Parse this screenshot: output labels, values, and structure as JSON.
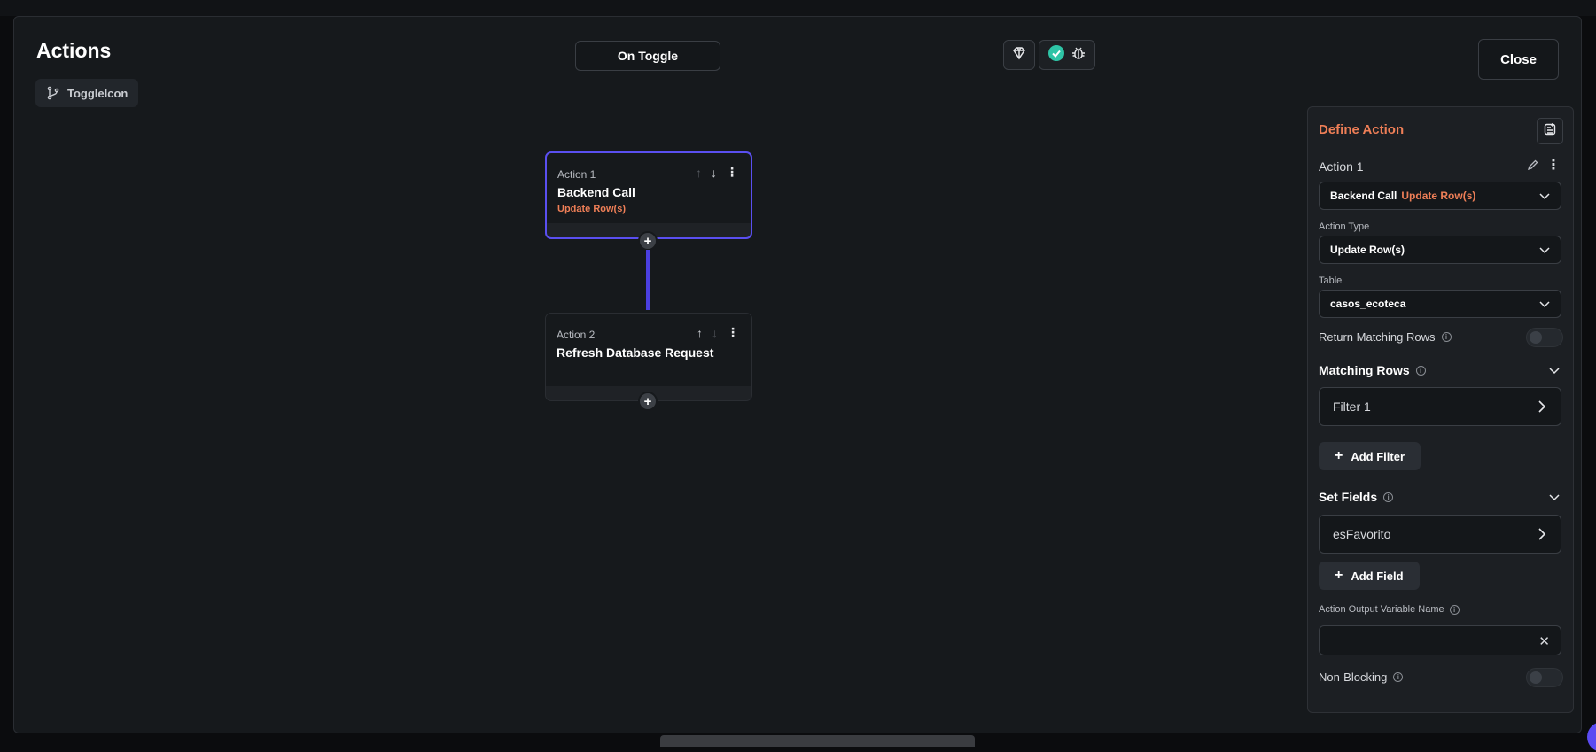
{
  "header": {
    "title": "Actions",
    "component_chip": "ToggleIcon",
    "trigger_label": "On Toggle",
    "close_label": "Close"
  },
  "flow": {
    "nodes": [
      {
        "label": "Action 1",
        "name": "Backend Call",
        "subtitle": "Update Row(s)"
      },
      {
        "label": "Action 2",
        "name": "Refresh Database Request",
        "subtitle": ""
      }
    ]
  },
  "panel": {
    "title": "Define Action",
    "action_label": "Action 1",
    "action_select_main": "Backend Call",
    "action_select_sub": "Update Row(s)",
    "action_type_label": "Action Type",
    "action_type_value": "Update Row(s)",
    "table_label": "Table",
    "table_value": "casos_ecoteca",
    "return_matching_rows_label": "Return Matching Rows",
    "matching_rows_heading": "Matching Rows",
    "filter_item": "Filter 1",
    "add_filter_label": "Add Filter",
    "set_fields_heading": "Set Fields",
    "field_item": "esFavorito",
    "add_field_label": "Add Field",
    "output_variable_label": "Action Output Variable Name",
    "output_variable_value": "",
    "non_blocking_label": "Non-Blocking"
  },
  "colors": {
    "accent": "#5a4ff0",
    "highlight": "#ef7f57",
    "success": "#2ec4a6"
  }
}
